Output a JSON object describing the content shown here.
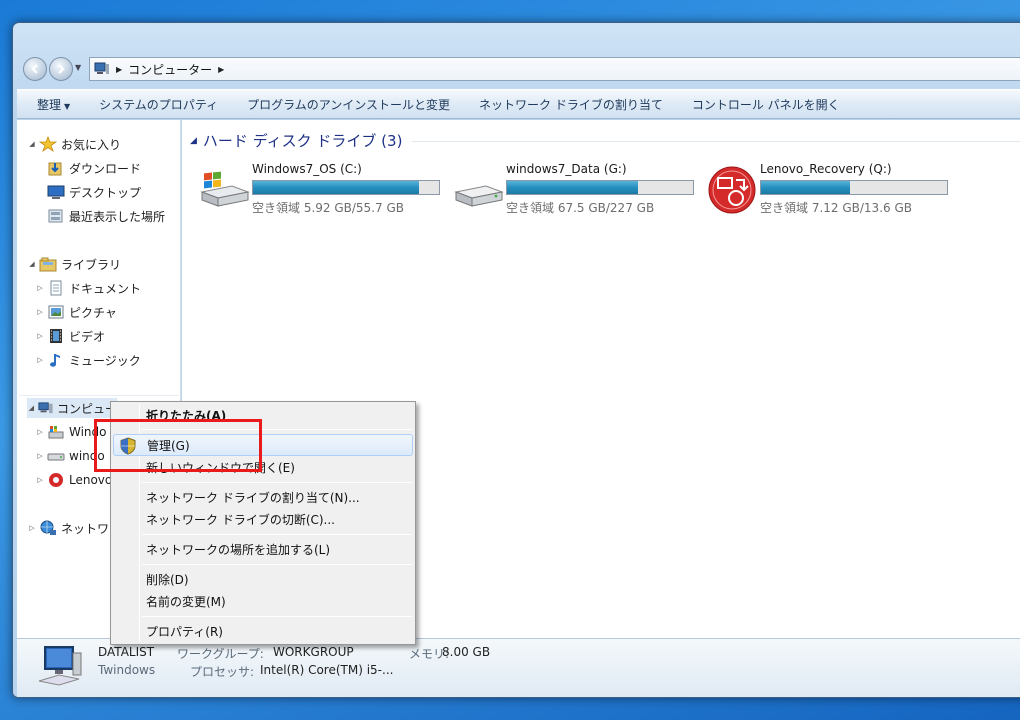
{
  "address": {
    "crumbs": [
      "コンピューター"
    ]
  },
  "commandbar": {
    "items": [
      "整理",
      "システムのプロパティ",
      "プログラムのアンインストールと変更",
      "ネットワーク ドライブの割り当て",
      "コントロール パネルを開く"
    ]
  },
  "navpane": {
    "favorites": {
      "label": "お気に入り",
      "children": [
        "ダウンロード",
        "デスクトップ",
        "最近表示した場所"
      ]
    },
    "libraries": {
      "label": "ライブラリ",
      "children": [
        "ドキュメント",
        "ピクチャ",
        "ビデオ",
        "ミュージック"
      ]
    },
    "computer": {
      "label": "コンピュー",
      "children": [
        "Windo",
        "windo",
        "Lenovo"
      ]
    },
    "network": {
      "label": "ネットワ"
    }
  },
  "content": {
    "group_title": "ハード ディスク ドライブ (3)",
    "drives": [
      {
        "name": "Windows7_OS (C:)",
        "free": "空き領域 5.92 GB/55.7 GB",
        "used_fraction": 0.894
      },
      {
        "name": "windows7_Data (G:)",
        "free": "空き領域 67.5 GB/227 GB",
        "used_fraction": 0.703
      },
      {
        "name": "Lenovo_Recovery (Q:)",
        "free": "空き領域 7.12 GB/13.6 GB",
        "used_fraction": 0.476
      }
    ]
  },
  "details": {
    "name": "DATALIST",
    "sub": "Twindows",
    "workgroup_label": "ワークグループ:",
    "workgroup_value": "WORKGROUP",
    "memory_label": "メモリ:",
    "memory_value": "8.00 GB",
    "processor_label": "プロセッサ:",
    "processor_value": "Intel(R) Core(TM) i5-..."
  },
  "contextmenu": {
    "collapse": "折りたたみ(A)",
    "manage": "管理(G)",
    "open_new": "新しいウィンドウで開く(E)",
    "map_drive": "ネットワーク ドライブの割り当て(N)...",
    "disconnect_drive": "ネットワーク ドライブの切断(C)...",
    "add_location": "ネットワークの場所を追加する(L)",
    "delete": "削除(D)",
    "rename": "名前の変更(M)",
    "properties": "プロパティ(R)"
  },
  "colors": {
    "accent": "#1e3287",
    "highlight_border": "#e81a1a",
    "bar_fill": "#268fbf"
  }
}
